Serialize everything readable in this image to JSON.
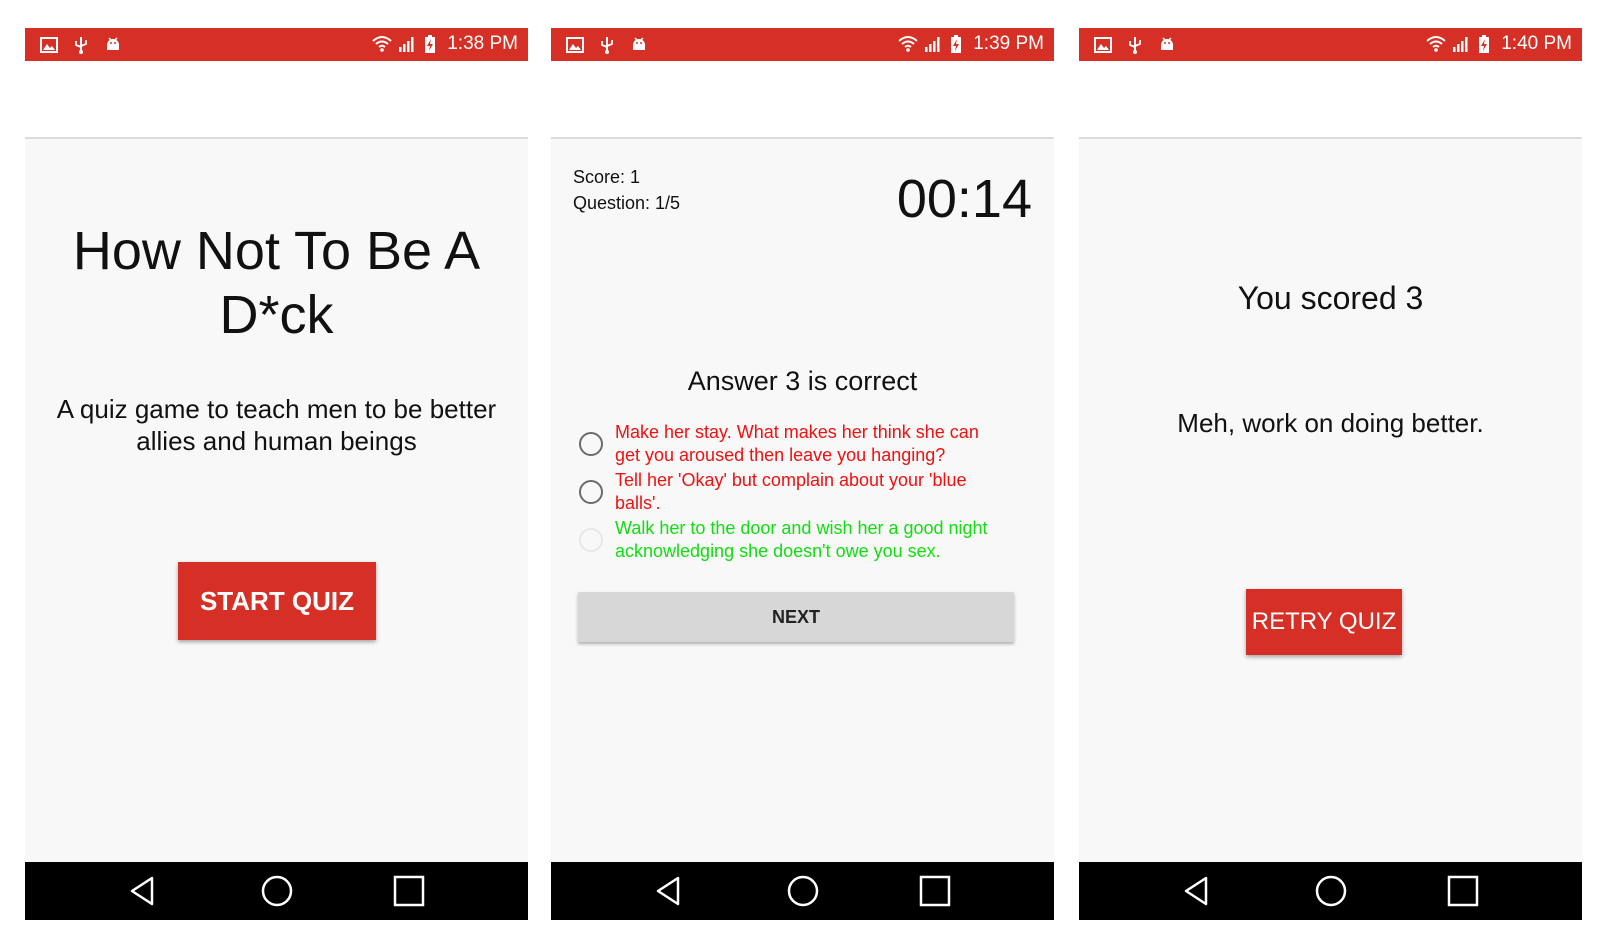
{
  "colors": {
    "accent_red": "#d63026",
    "content_bg": "#f8f8f8",
    "wrong_answer": "#ee1111",
    "correct_answer": "#11dd11",
    "next_button_bg": "#d7d7d7"
  },
  "screens": [
    {
      "status_bar": {
        "time": "1:38 PM"
      },
      "title": "How Not To Be A D*ck",
      "subtitle": "A quiz game to teach men to be better allies and human beings",
      "start_button_label": "START QUIZ"
    },
    {
      "status_bar": {
        "time": "1:39 PM"
      },
      "score_text": "Score: 1",
      "question_text": "Question: 1/5",
      "timer": "00:14",
      "result_message": "Answer 3 is correct",
      "answers": [
        {
          "text": "Make her stay. What makes her think she can get you aroused then leave you hanging?",
          "status": "wrong"
        },
        {
          "text": "Tell her 'Okay' but complain about your 'blue balls'.",
          "status": "wrong"
        },
        {
          "text": "Walk her to the door and wish her a good night acknowledging she doesn't owe you sex.",
          "status": "correct"
        }
      ],
      "next_button_label": "NEXT"
    },
    {
      "status_bar": {
        "time": "1:40 PM"
      },
      "score_result": "You scored 3",
      "feedback": "Meh, work on doing better.",
      "retry_button_label": "RETRY QUIZ"
    }
  ],
  "icons": {
    "status_left": [
      "image-icon",
      "usb-icon",
      "android-debug-icon"
    ],
    "status_right": [
      "wifi-icon",
      "signal-icon",
      "battery-charging-icon"
    ],
    "nav": [
      "back-icon",
      "home-icon",
      "recents-icon"
    ]
  }
}
